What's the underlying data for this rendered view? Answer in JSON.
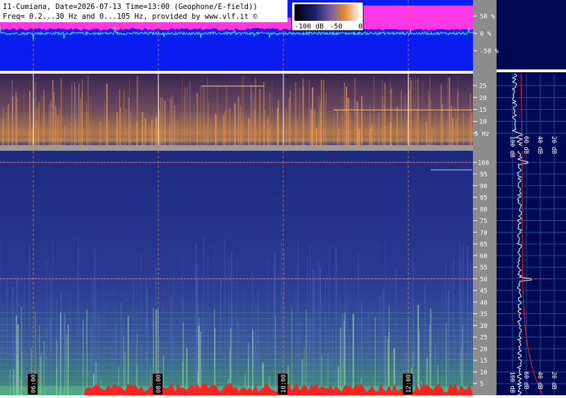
{
  "header": {
    "title_line1": "I1-Cumiana, Date=2026-07-13 Time=13:00 (Geophone/E-field))",
    "title_line2": "Freq= 0.2...30 Hz and 0...105 Hz, provided by www.vlf.it ©"
  },
  "colors": {
    "waveform_bg": "#0a1df0",
    "magenta": "#ff38e6",
    "cyan": "#3fe8e0",
    "right_panel_bg": "#000a52",
    "scale_panel": "#8c8c8c",
    "marker_orange": "#ff8a00",
    "red_trace": "#ff2020"
  },
  "colorbar": {
    "ticks": [
      "-100 dB",
      "-50",
      "0"
    ]
  },
  "chart_data": [
    {
      "type": "line",
      "name": "waveform",
      "yticks": [
        "50 %",
        "0 %",
        "-50 %"
      ],
      "y_values": [
        50,
        0,
        -50
      ],
      "ylim": [
        -100,
        100
      ]
    },
    {
      "type": "heatmap",
      "name": "spectrogram-low",
      "ylabel_unit": "Hz",
      "yticks": [
        "25",
        "20",
        "15",
        "10",
        "5 Hz"
      ],
      "y_values": [
        25,
        20,
        15,
        10,
        5
      ],
      "ylim": [
        0,
        30
      ]
    },
    {
      "type": "heatmap",
      "name": "spectrogram-high",
      "yticks": [
        "100",
        "95",
        "90",
        "85",
        "80",
        "75",
        "70",
        "65",
        "60",
        "55",
        "50",
        "45",
        "40",
        "35",
        "30",
        "25",
        "20",
        "15",
        "10",
        "5"
      ],
      "y_values": [
        100,
        95,
        90,
        85,
        80,
        75,
        70,
        65,
        60,
        55,
        50,
        45,
        40,
        35,
        30,
        25,
        20,
        15,
        10,
        5
      ],
      "ylim": [
        0,
        105
      ],
      "lines_hz": [
        100,
        50
      ]
    },
    {
      "type": "line",
      "name": "time-axis",
      "xticks": [
        "06:00",
        "08:00",
        "10:00",
        "12:00"
      ]
    },
    {
      "type": "line",
      "name": "spectrum-profile-low",
      "xticks": [
        "100 dB",
        "60 dB",
        "40 dB",
        "20 dB"
      ]
    },
    {
      "type": "line",
      "name": "spectrum-profile-high",
      "xticks": [
        "100 dB",
        "60 dB",
        "40 dB",
        "20 dB"
      ]
    }
  ]
}
